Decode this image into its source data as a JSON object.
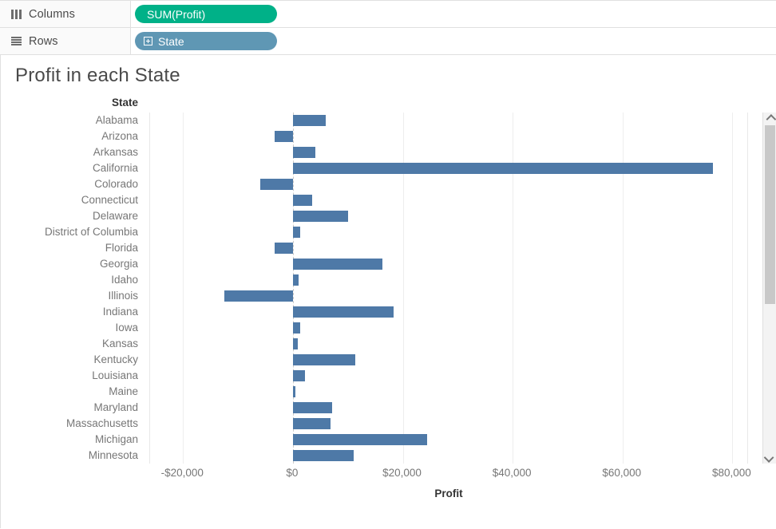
{
  "shelves": [
    {
      "name": "columns",
      "label": "Columns",
      "icon": "columns-icon",
      "pill": {
        "label": "SUM(Profit)",
        "type": "measure",
        "color": "#00b188",
        "icon": null
      }
    },
    {
      "name": "rows",
      "label": "Rows",
      "icon": "rows-icon",
      "pill": {
        "label": "State",
        "type": "dimension",
        "color": "#5f97b4",
        "icon": "plus-box-icon"
      }
    }
  ],
  "worksheet": {
    "title": "Profit in each State",
    "field_header": "State",
    "bar_color": "#4e79a7"
  },
  "scrollbar": {
    "up_arrow": "chevron-up-icon",
    "down_arrow": "chevron-down-icon",
    "thumb_position_percent": 0,
    "thumb_size_percent": 55
  },
  "chart_data": {
    "type": "bar",
    "orientation": "horizontal",
    "title": "Profit in each State",
    "xlabel": "Profit",
    "ylabel": "State",
    "xlim": [
      -26000,
      83000
    ],
    "xticks": [
      -20000,
      0,
      20000,
      40000,
      60000,
      80000
    ],
    "xticklabels": [
      "-$20,000",
      "$0",
      "$20,000",
      "$40,000",
      "$60,000",
      "$80,000"
    ],
    "grid": true,
    "legend": false,
    "categories": [
      "Alabama",
      "Arizona",
      "Arkansas",
      "California",
      "Colorado",
      "Connecticut",
      "Delaware",
      "District of Columbia",
      "Florida",
      "Georgia",
      "Idaho",
      "Illinois",
      "Indiana",
      "Iowa",
      "Kansas",
      "Kentucky",
      "Louisiana",
      "Maine",
      "Maryland",
      "Massachusetts",
      "Michigan",
      "Minnesota"
    ],
    "values": [
      6000,
      -3400,
      4100,
      76500,
      -5900,
      3500,
      10100,
      1300,
      -3400,
      16300,
      1000,
      -12500,
      18400,
      1300,
      850,
      11300,
      2200,
      450,
      7100,
      6900,
      24400,
      11000
    ]
  }
}
